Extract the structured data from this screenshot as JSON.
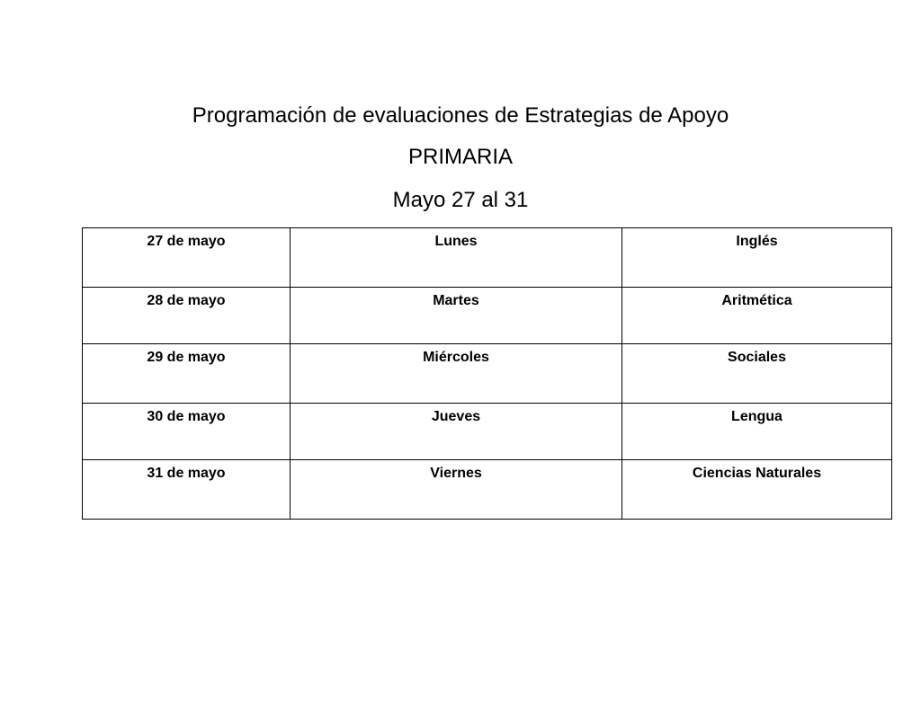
{
  "document": {
    "title": "Programación de evaluaciones de Estrategias de Apoyo",
    "level": "PRIMARIA",
    "date_range": "Mayo 27 al 31"
  },
  "schedule": {
    "rows": [
      {
        "date": "27 de mayo",
        "day": "Lunes",
        "subject": "Inglés"
      },
      {
        "date": "28 de mayo",
        "day": "Martes",
        "subject": "Aritmética"
      },
      {
        "date": "29 de mayo",
        "day": "Miércoles",
        "subject": "Sociales"
      },
      {
        "date": "30 de mayo",
        "day": "Jueves",
        "subject": "Lengua"
      },
      {
        "date": "31 de mayo",
        "day": "Viernes",
        "subject": "Ciencias Naturales"
      }
    ]
  },
  "colors": {
    "text": "#000000",
    "border": "#000000",
    "background": "#ffffff"
  }
}
